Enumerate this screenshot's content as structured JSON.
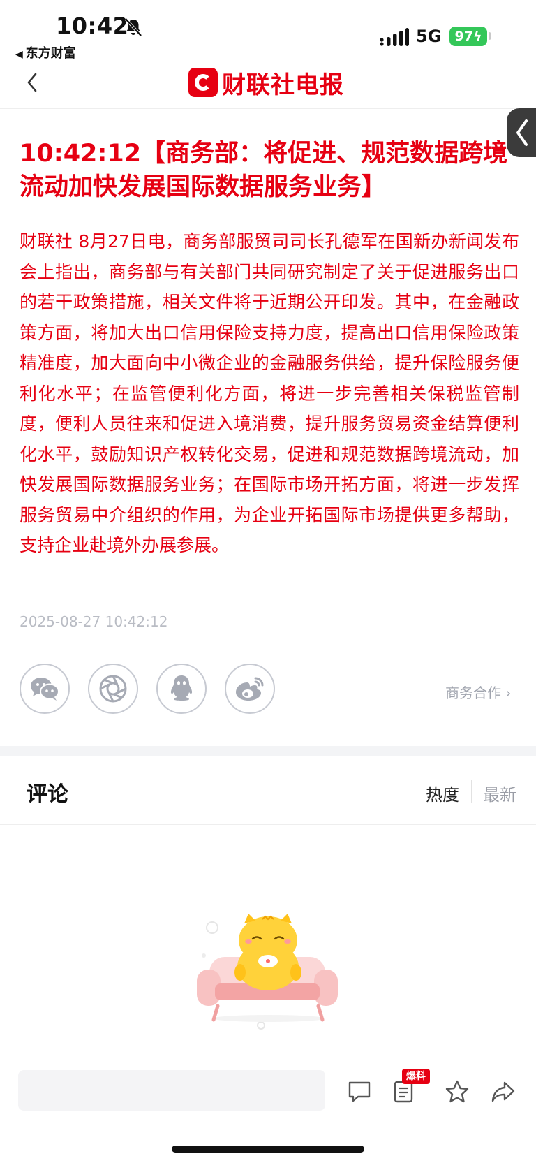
{
  "status_bar": {
    "time": "10:42",
    "back_app": "东方财富",
    "network": "5G",
    "battery": "97"
  },
  "nav": {
    "brand_name": "财联社电报",
    "back_icon": "chevron-left-icon"
  },
  "article": {
    "headline": "10:42:12【商务部：将促进、规范数据跨境流动加快发展国际数据服务业务】",
    "body": "财联社 8月27日电，商务部服贸司司长孔德军在国新办新闻发布会上指出，商务部与有关部门共同研究制定了关于促进服务出口的若干政策措施，相关文件将于近期公开印发。其中，在金融政策方面，将加大出口信用保险支持力度，提高出口信用保险政策精准度，加大面向中小微企业的金融服务供给，提升保险服务便利化水平；在监管便利化方面，将进一步完善相关保税监管制度，便利人员往来和促进入境消费，提升服务贸易资金结算便利化水平，鼓励知识产权转化交易，促进和规范数据跨境流动，加快发展国际数据服务业务；在国际市场开拓方面，将进一步发挥服务贸易中介组织的作用，为企业开拓国际市场提供更多帮助，支持企业赴境外办展参展。",
    "timestamp": "2025-08-27 10:42:12"
  },
  "share": {
    "icons": [
      "wechat-icon",
      "moments-icon",
      "qq-icon",
      "weibo-icon"
    ],
    "business_link": "商务合作 ›"
  },
  "comments": {
    "title": "评论",
    "sort_hot": "热度",
    "sort_new": "最新"
  },
  "bottom_bar": {
    "badge": "爆料",
    "icons": [
      "comment-icon",
      "news-report-icon",
      "star-icon",
      "share-icon"
    ]
  },
  "colors": {
    "brand_red": "#e60012",
    "battery_green": "#34c759",
    "muted_gray": "#b9bcc4"
  }
}
